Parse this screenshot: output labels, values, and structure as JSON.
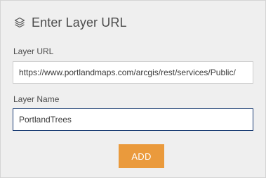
{
  "header": {
    "icon": "layers-icon",
    "title": "Enter Layer URL"
  },
  "form": {
    "url_label": "Layer URL",
    "url_value": "https://www.portlandmaps.com/arcgis/rest/services/Public/",
    "name_label": "Layer Name",
    "name_value": "PortlandTrees"
  },
  "actions": {
    "add_label": "ADD"
  },
  "colors": {
    "panel_background": "#efefef",
    "add_button": "#ea9a3c",
    "focused_input_border": "#1a3c73",
    "text": "#4c4c4c"
  }
}
